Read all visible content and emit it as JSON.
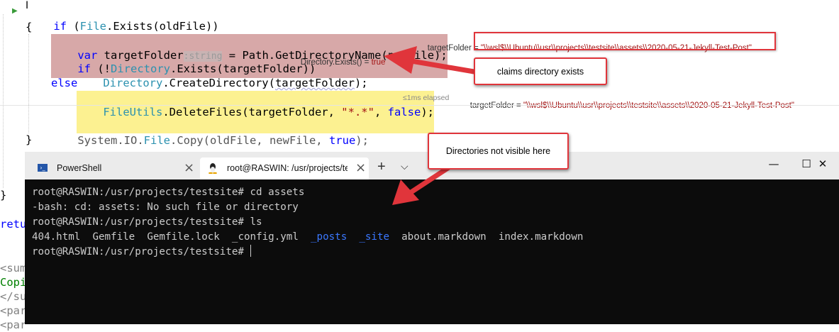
{
  "editor": {
    "line_if": [
      "if",
      " (",
      "File",
      ".Exists(oldFile))"
    ],
    "brace_open": "{",
    "line_var": {
      "kw": "var",
      "name": " targetFolder",
      "hint": ":string",
      "rest": " = Path.GetDirectoryName(newFile);"
    },
    "line_if2": {
      "kw": "if",
      "p1": " (!",
      "type": "Directory",
      "rest": ".Exists(targetFolder))"
    },
    "line_create": {
      "type": "Directory",
      "p1": ".CreateDirectory(",
      "arg": "targetFolder",
      "p2": ");"
    },
    "line_else": "else",
    "line_delete": {
      "type": "FileUtils",
      "p1": ".DeleteFiles(targetFolder, ",
      "str": "\"*.*\"",
      "p2": ", ",
      "kw": "false",
      "p3": ");"
    },
    "elapsed": "≤1ms elapsed",
    "line_copy": {
      "p1": "System.IO.",
      "type": "File",
      "p2": ".Copy(oldFile, newFile, ",
      "kw": "true",
      "p3": ");"
    },
    "brace_close": "}",
    "brace_close2": "}",
    "return_fragment": "retu",
    "left_fragments": [
      "<sum",
      "Copi",
      "</su",
      "<par",
      "<par"
    ],
    "datatip_var": {
      "label": "targetFolder = ",
      "value": "\"\\\\wsl$\\\\Ubuntu\\\\usr\\\\projects\\\\testsite\\\\assets\\\\2020-05-21-Jekyll-Test-Post\""
    },
    "datatip_exists": {
      "label": "Directory.Exists() = ",
      "value": "true"
    },
    "datatip_delete": {
      "label": "targetFolder = ",
      "value": "\"\\\\wsl$\\\\Ubuntu\\\\usr\\\\projects\\\\testsite\\\\assets\\\\2020-05-21-Jekyll-Test-Post\""
    }
  },
  "annotations": {
    "claims": "claims directory exists",
    "not_visible": "Directories not visible here"
  },
  "terminal": {
    "tabs": [
      {
        "label": "PowerShell",
        "icon": "powershell-icon"
      },
      {
        "label": "root@RASWIN: /usr/projects/te",
        "icon": "linux-penguin-icon"
      }
    ],
    "new_tab": "+",
    "dropdown": "⌵",
    "window_controls": {
      "minimize": "—",
      "maximize": "☐",
      "close": "✕"
    },
    "prompt": "root@RASWIN:/usr/projects/testsite#",
    "lines": [
      {
        "prompt": "root@RASWIN:/usr/projects/testsite#",
        "cmd": " cd assets"
      },
      {
        "output": "-bash: cd: assets: No such file or directory"
      },
      {
        "prompt": "root@RASWIN:/usr/projects/testsite#",
        "cmd": " ls"
      }
    ],
    "ls_output": [
      "404.html",
      "Gemfile",
      "Gemfile.lock",
      "_config.yml",
      "_posts",
      "_site",
      "about.markdown",
      "index.markdown"
    ]
  },
  "colors": {
    "accent_red": "#e0353b",
    "keyword_blue": "#0000ff",
    "type_teal": "#2b91af",
    "string_red": "#a31515",
    "terminal_bg": "#0c0c0c",
    "terminal_dir_blue": "#3b78ff"
  }
}
